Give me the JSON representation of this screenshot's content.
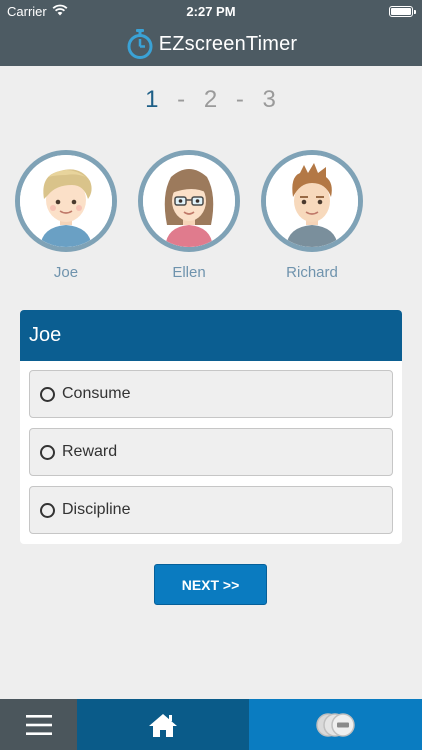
{
  "status_bar": {
    "carrier": "Carrier",
    "time": "2:27 PM"
  },
  "header": {
    "app_title": "EZscreenTimer"
  },
  "steps": {
    "step1": "1",
    "step2": "2",
    "step3": "3",
    "separator": "-",
    "active": 1
  },
  "profiles": [
    {
      "name": "Joe"
    },
    {
      "name": "Ellen"
    },
    {
      "name": "Richard"
    }
  ],
  "card": {
    "title": "Joe",
    "options": [
      {
        "label": "Consume"
      },
      {
        "label": "Reward"
      },
      {
        "label": "Discipline"
      }
    ]
  },
  "next_label": "NEXT >>",
  "bottom_nav": {
    "icons": [
      "menu-icon",
      "home-icon",
      "coins-icon"
    ]
  },
  "colors": {
    "header_bg": "#4d5b63",
    "card_header": "#0b5e91",
    "button": "#0a7bc0",
    "avatar_ring": "#7fa2b6"
  }
}
